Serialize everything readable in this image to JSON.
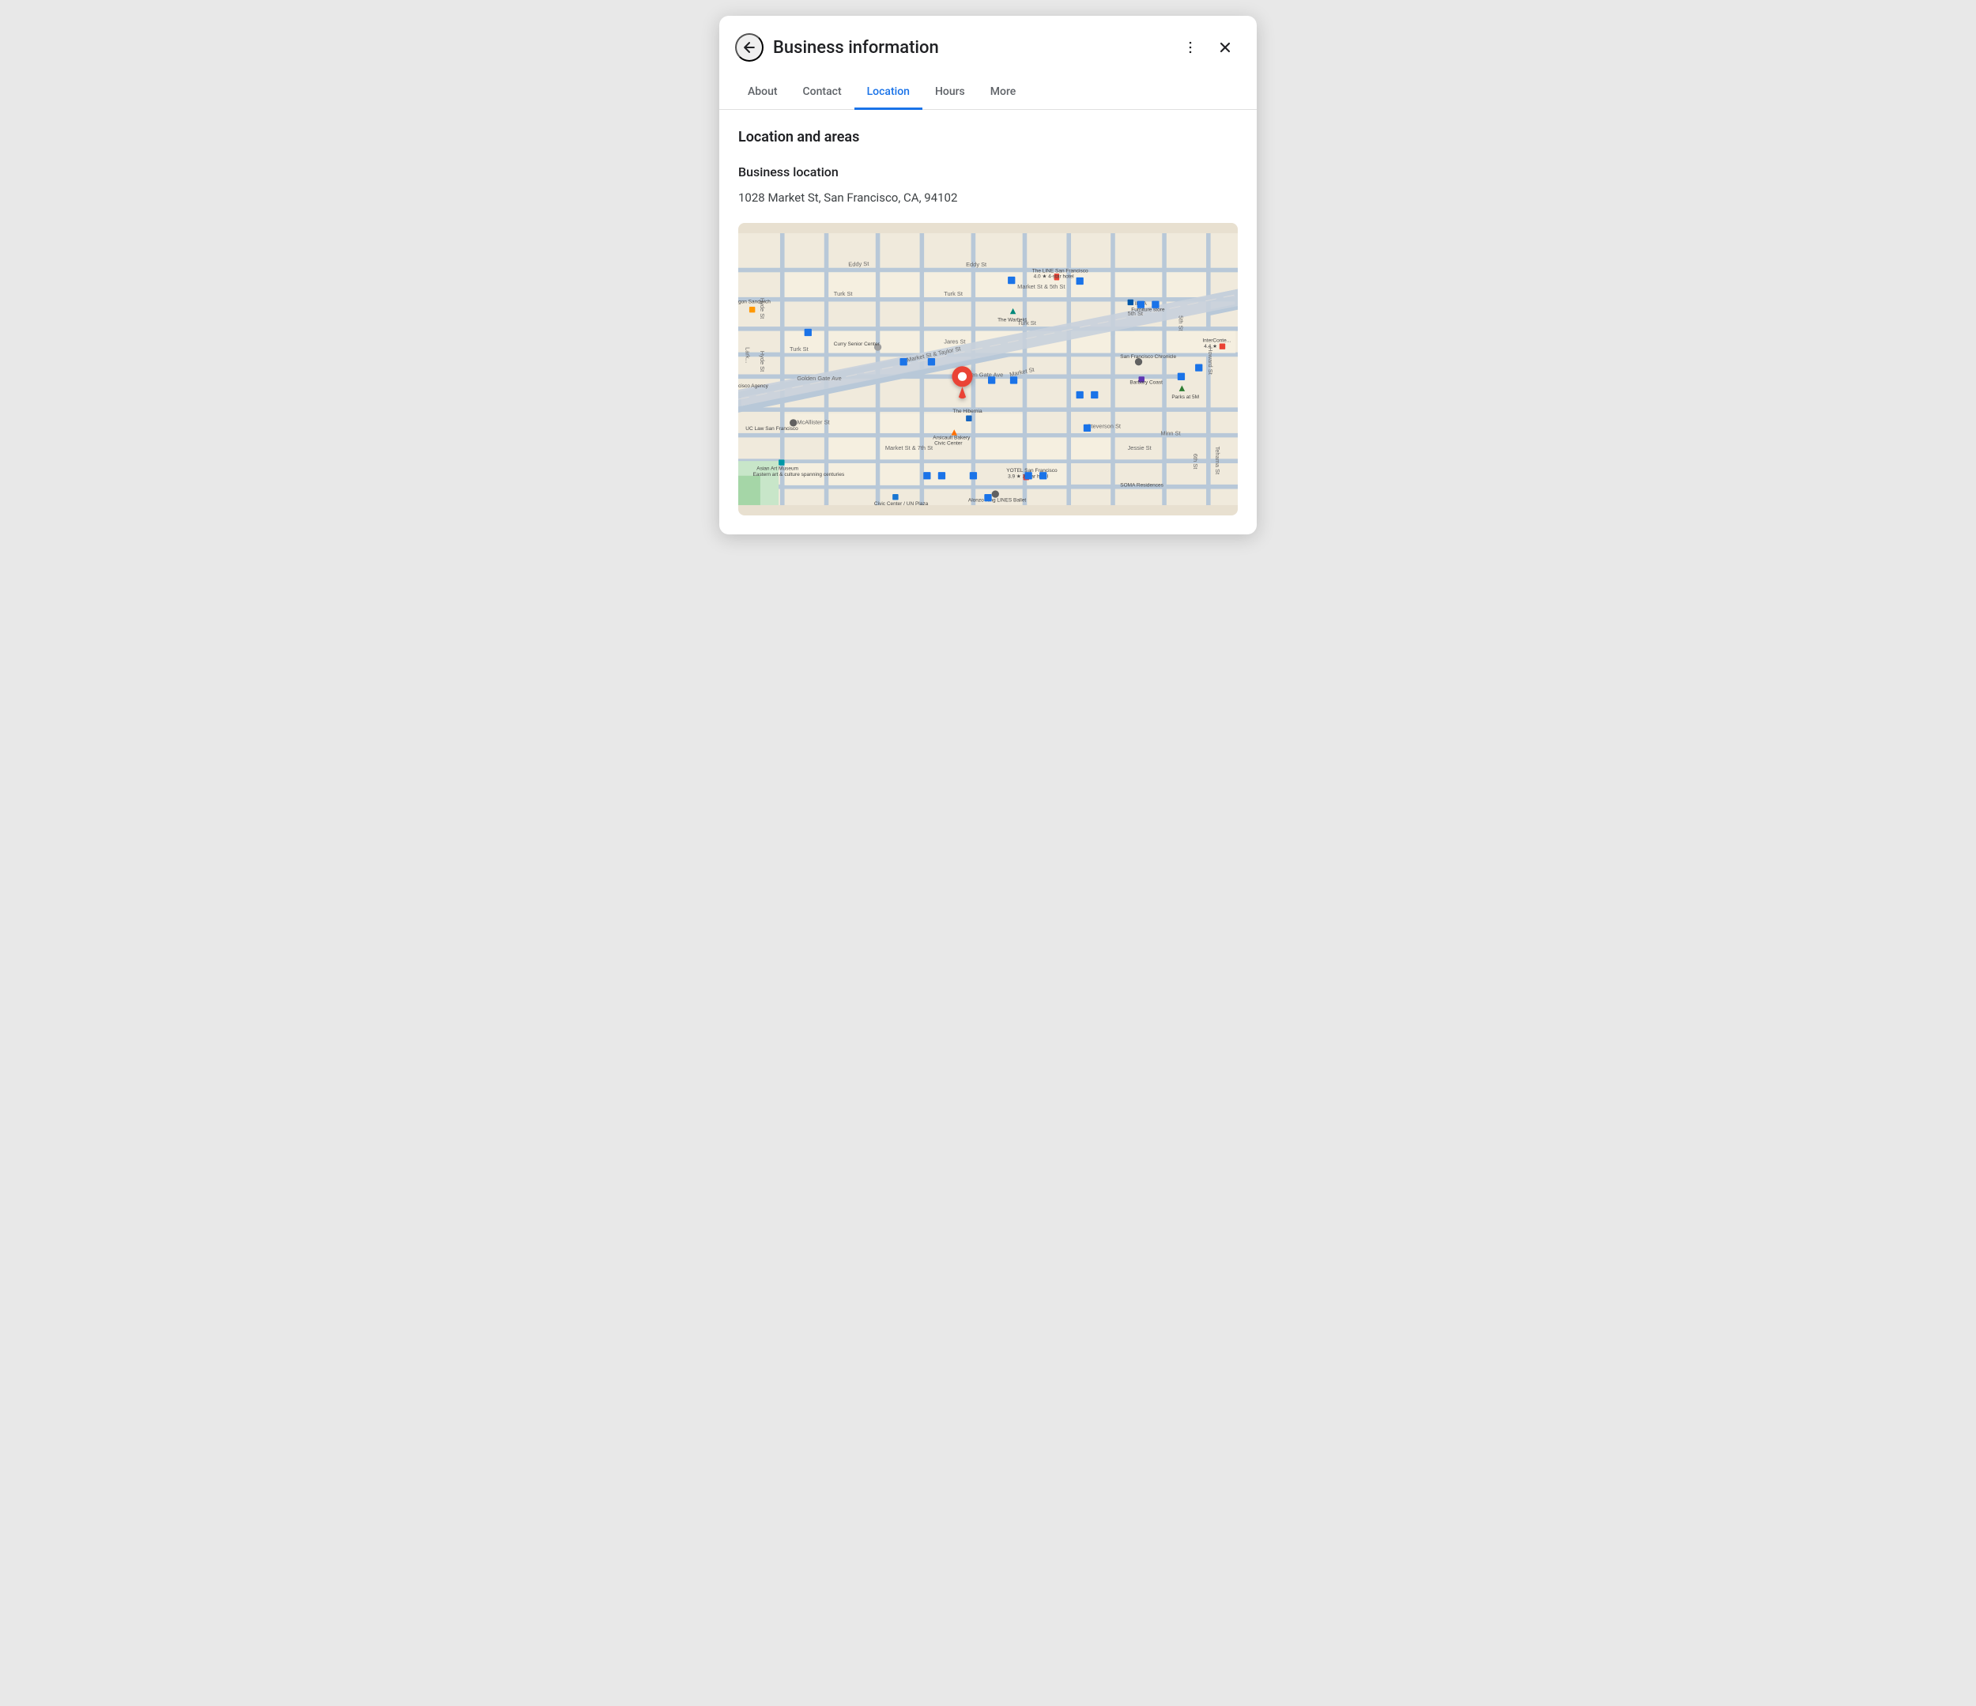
{
  "header": {
    "title": "Business information",
    "back_icon": "←",
    "more_icon": "⋮",
    "close_icon": "×"
  },
  "tabs": [
    {
      "id": "about",
      "label": "About",
      "active": false
    },
    {
      "id": "contact",
      "label": "Contact",
      "active": false
    },
    {
      "id": "location",
      "label": "Location",
      "active": true
    },
    {
      "id": "hours",
      "label": "Hours",
      "active": false
    },
    {
      "id": "more",
      "label": "More",
      "active": false
    }
  ],
  "content": {
    "section_title": "Location and areas",
    "subsection_title": "Business location",
    "address": "1028 Market St, San Francisco, CA, 94102"
  },
  "map": {
    "alt": "Map showing 1028 Market St, San Francisco"
  }
}
